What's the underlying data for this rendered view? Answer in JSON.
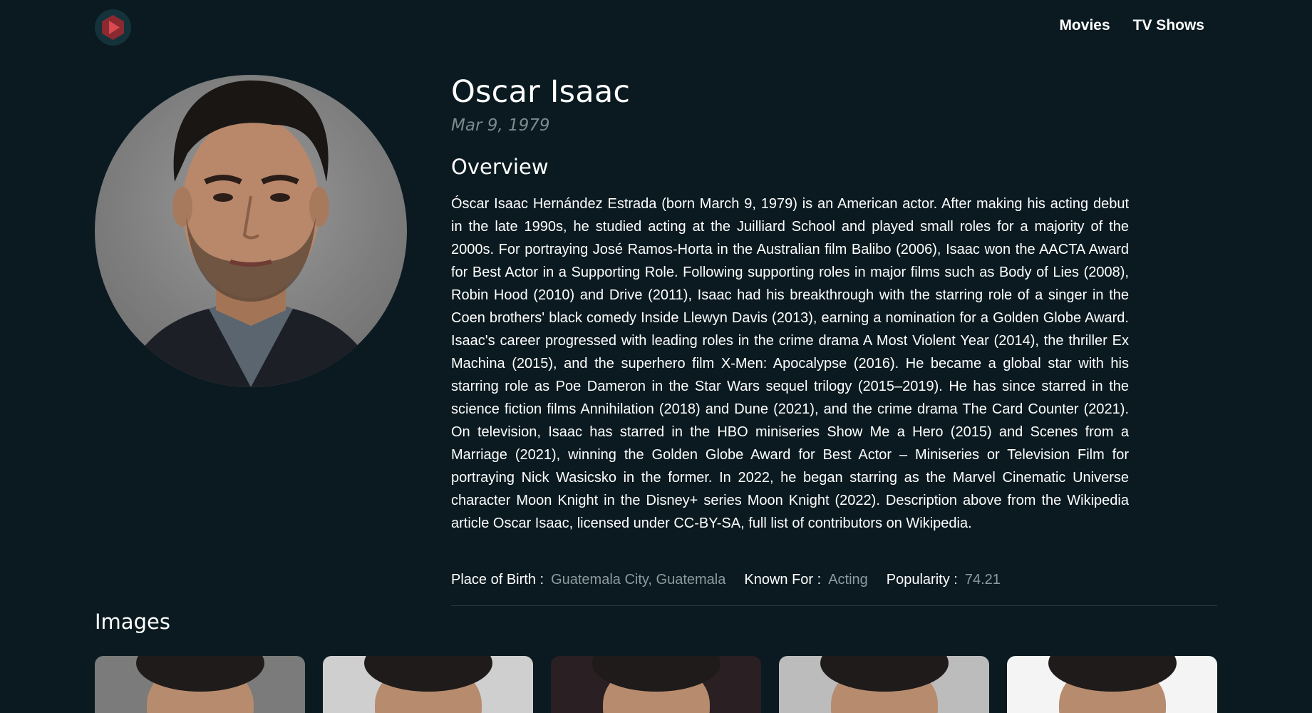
{
  "header": {
    "logo_icon": "play-icon",
    "brand_color": "#c0333c",
    "nav": [
      {
        "label": "Movies"
      },
      {
        "label": "TV Shows"
      }
    ]
  },
  "person": {
    "name": "Oscar Isaac",
    "birth_date": "Mar 9, 1979",
    "overview_heading": "Overview",
    "overview": "Óscar Isaac Hernández Estrada (born March 9, 1979) is an American actor. After making his acting debut in the late 1990s, he studied acting at the Juilliard School and played small roles for a majority of the 2000s. For portraying José Ramos-Horta in the Australian film Balibo (2006), Isaac won the AACTA Award for Best Actor in a Supporting Role. Following supporting roles in major films such as Body of Lies (2008), Robin Hood (2010) and Drive (2011), Isaac had his breakthrough with the starring role of a singer in the Coen brothers' black comedy Inside Llewyn Davis (2013), earning a nomination for a Golden Globe Award. Isaac's career progressed with leading roles in the crime drama A Most Violent Year (2014), the thriller Ex Machina (2015), and the superhero film X-Men: Apocalypse (2016). He became a global star with his starring role as Poe Dameron in the Star Wars sequel trilogy (2015–2019). He has since starred in the science fiction films Annihilation (2018) and Dune (2021), and the crime drama The Card Counter (2021). On television, Isaac has starred in the HBO miniseries Show Me a Hero (2015) and Scenes from a Marriage (2021), winning the Golden Globe Award for Best Actor – Miniseries or Television Film for portraying Nick Wasicsko in the former. In 2022, he began starring as the Marvel Cinematic Universe character Moon Knight in the Disney+ series Moon Knight (2022). Description above from the Wikipedia article Oscar Isaac, licensed under CC-BY-SA, full list of contributors on Wikipedia.",
    "facts": [
      {
        "label": "Place of Birth :",
        "value": "Guatemala City, Guatemala"
      },
      {
        "label": "Known For :",
        "value": "Acting"
      },
      {
        "label": "Popularity :",
        "value": "74.21"
      }
    ]
  },
  "images": {
    "heading": "Images",
    "thumb_backgrounds": [
      "#7b7b7b",
      "#cfcfcf",
      "#2a1f22",
      "#bcbcbc",
      "#f4f4f4"
    ]
  }
}
